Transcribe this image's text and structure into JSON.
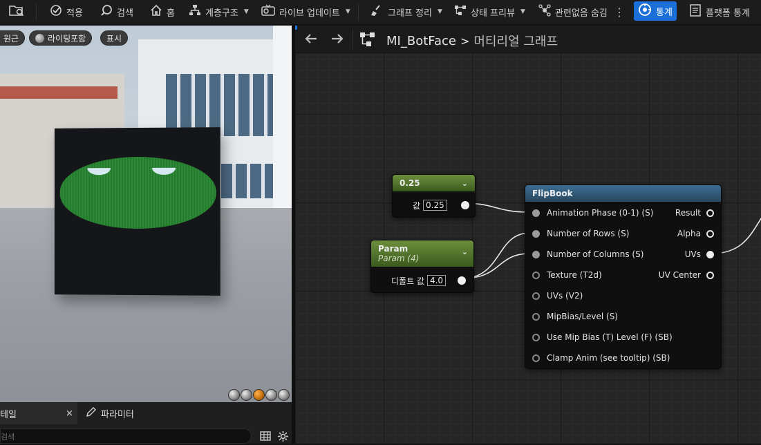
{
  "toolbar": {
    "apply": "적용",
    "search": "검색",
    "home": "홈",
    "hierarchy": "계층구조",
    "live_update": "라이브 업데이트",
    "clean_graph": "그래프 정리",
    "state_preview": "상태 프리뷰",
    "hide_unrelated": "관련없음 숨김",
    "stats": "통계",
    "platform_stats": "플랫폼 통계"
  },
  "viewport": {
    "chip_perspective": "원근",
    "chip_lighting": "라이팅포함",
    "chip_show": "표시"
  },
  "bottom_panel": {
    "tab_details": "테일",
    "tab_parameters": "파라미터",
    "search_placeholder": "검색"
  },
  "graph": {
    "breadcrumb_material": "MI_BotFace",
    "breadcrumb_separator": ">",
    "breadcrumb_graph": "머티리얼 그래프"
  },
  "nodes": {
    "constant": {
      "title": "0.25",
      "value_label": "값",
      "value": "0.25"
    },
    "param": {
      "title": "Param",
      "subtitle": "Param (4)",
      "value_label": "디폴트 값",
      "value": "4.0"
    },
    "flipbook": {
      "title": "FlipBook",
      "inputs": [
        "Animation  Phase (0-1) (S)",
        "Number of Rows (S)",
        "Number of Columns (S)",
        "Texture (T2d)",
        "UVs (V2)",
        "MipBias/Level (S)",
        "Use Mip Bias (T) Level (F) (SB)",
        "Clamp Anim (see tooltip) (SB)"
      ],
      "outputs": [
        "Result",
        "Alpha",
        "UVs",
        "UV Center"
      ]
    }
  },
  "colors": {
    "accent": "#1a6fd8",
    "param_header": "#4a6e28",
    "flipbook_header": "#2f5673"
  }
}
